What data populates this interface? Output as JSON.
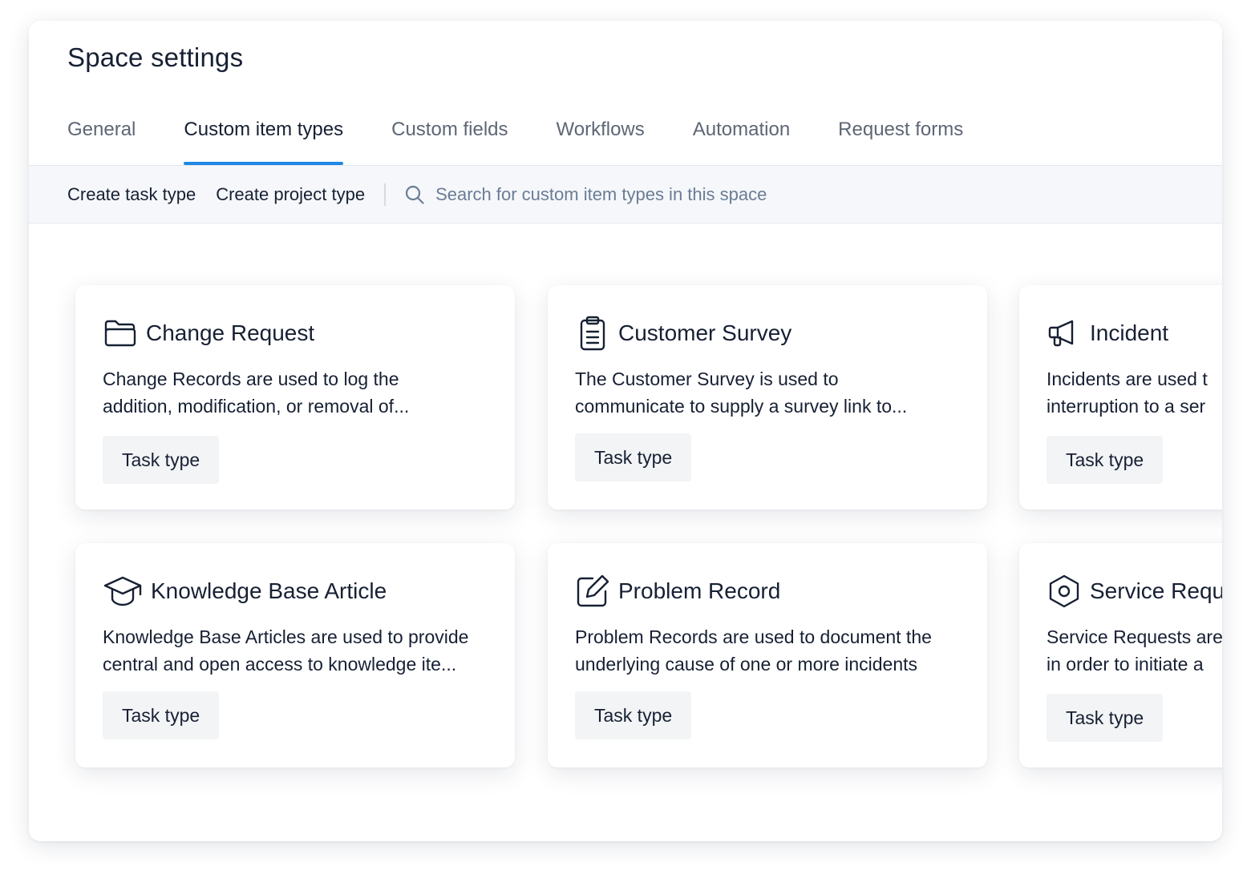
{
  "page": {
    "title": "Space settings"
  },
  "tabs": [
    {
      "label": "General",
      "active": false
    },
    {
      "label": "Custom item types",
      "active": true
    },
    {
      "label": "Custom fields",
      "active": false
    },
    {
      "label": "Workflows",
      "active": false
    },
    {
      "label": "Automation",
      "active": false
    },
    {
      "label": "Request forms",
      "active": false
    }
  ],
  "toolbar": {
    "create_task_label": "Create task type",
    "create_project_label": "Create project type",
    "search": {
      "placeholder": "Search for custom item types in this space",
      "value": "",
      "icon": "search-icon"
    }
  },
  "cards": [
    {
      "icon": "folder-icon",
      "title": "Change Request",
      "desc_line1": "Change Records are used to log the",
      "desc_line2": "addition, modification, or removal of...",
      "badge": "Task type"
    },
    {
      "icon": "clipboard-icon",
      "title": "Customer Survey",
      "desc_line1": "The Customer Survey is used to",
      "desc_line2": "communicate to supply a survey link to...",
      "badge": "Task type"
    },
    {
      "icon": "megaphone-icon",
      "title": "Incident",
      "desc_line1": "Incidents are used t",
      "desc_line2": "interruption to a ser",
      "badge": "Task type"
    },
    {
      "icon": "graduation-cap-icon",
      "title": "Knowledge Base Article",
      "desc_line1": "Knowledge Base Articles are used to provide",
      "desc_line2": "central and open access to knowledge ite...",
      "badge": "Task type"
    },
    {
      "icon": "edit-icon",
      "title": "Problem Record",
      "desc_line1": "Problem Records are used to document the",
      "desc_line2": "underlying cause of one or more incidents",
      "badge": "Task type"
    },
    {
      "icon": "hex-nut-icon",
      "title": "Service Requ",
      "desc_line1": "Service Requests are",
      "desc_line2": "in order to initiate a",
      "badge": "Task type"
    }
  ],
  "colors": {
    "accent": "#1f87e5",
    "text": "#172033",
    "muted": "#5e6675",
    "toolbar_bg": "#f5f7fa",
    "badge_bg": "#f3f4f6"
  }
}
